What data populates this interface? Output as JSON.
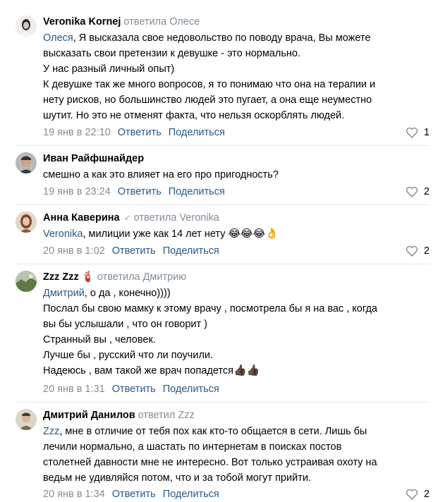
{
  "comments": [
    {
      "author": "Veronika Kornej",
      "reply_to": "ответила Олесе",
      "mention": "Олеся",
      "lines": [
        ", Я высказала свое недовольство по поводу врача, Вы можете",
        "высказать свои претензии к девушке - это нормально.",
        "У нас разный личный опыт)",
        "К девушке так же много вопросов, я то понимаю что она на терапии и",
        "нету рисков, но большинство людей это пугает, а она еще неуместно",
        "шутит. Но это не отменят факта, что нельзя оскорблять людей."
      ],
      "date": "19 янв в 22:10",
      "reply_label": "Ответить",
      "share_label": "Поделиться",
      "likes": "1"
    },
    {
      "author": "Иван Райфшнайдер",
      "lines": [
        "смешно а как это влияет на его про пригодность?"
      ],
      "date": "19 янв в 23:24",
      "reply_label": "Ответить",
      "share_label": "Поделиться",
      "likes": "2"
    },
    {
      "author": "Анна Каверина",
      "reply_to": "ответила Veronika",
      "mention": "Veronika",
      "lines": [
        ", милиции уже как 14 лет нету"
      ],
      "emoji": "😂😂😂👌",
      "date": "20 янв в 1:02",
      "reply_label": "Ответить",
      "share_label": "Поделиться",
      "likes": "2"
    },
    {
      "author": "Zzz Zzz",
      "author_emoji": "🧯",
      "reply_to": "ответила Дмитрию",
      "mention": "Дмитрий",
      "lines": [
        ", о да , конечно))))",
        "Послал бы свою мамку к этому врачу , посмотрела бы я на вас , когда",
        "вы бы услышали , что он говорит )",
        "Странный вы , человек.",
        "Лучше бы , русский что ли поучили.",
        "Надеюсь , вам такой же врач попадется"
      ],
      "emoji": "👍🏿👍🏿",
      "date": "20 янв в 1:31",
      "reply_label": "Ответить",
      "share_label": "Поделиться"
    },
    {
      "author": "Дмитрий Данилов",
      "reply_to": "ответил Zzz",
      "mention": "Zzz",
      "lines": [
        ", мне в отличие от тебя пох как кто-то общается в сети. Лишь бы",
        "лечили нормально, а шастать по интернетам в поисках постов",
        "столетней давности мне не интересно. Вот только устраивая охоту на",
        "ведьм не удивляйся потом, что и за тобой могут прийти."
      ],
      "date": "20 янв в 1:34",
      "reply_label": "Ответить",
      "share_label": "Поделиться",
      "likes": "2"
    }
  ],
  "icons": {
    "heart": "heart-icon",
    "verified": "check-icon"
  },
  "colors": {
    "link": "#2a5885",
    "meta": "#818c99",
    "divider": "#e7e8ec"
  }
}
